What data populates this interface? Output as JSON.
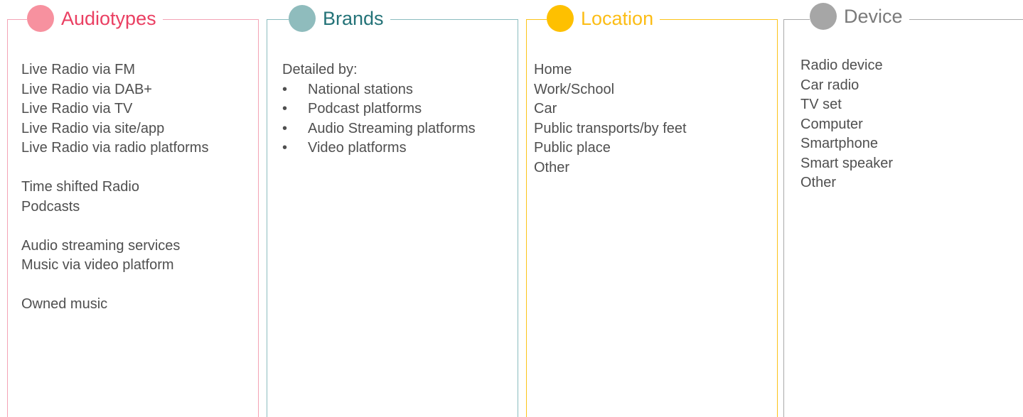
{
  "panels": [
    {
      "title": "Audiotypes",
      "groups": [
        [
          "Live Radio via FM",
          "Live Radio via DAB+",
          "Live Radio via TV",
          "Live Radio via site/app",
          "Live Radio via radio platforms"
        ],
        [
          "Time shifted Radio",
          "Podcasts"
        ],
        [
          "Audio streaming services",
          "Music via video platform"
        ],
        [
          "Owned music"
        ]
      ],
      "colors": {
        "dot": "#f7919f",
        "title": "#ea3f62",
        "border": "#f4a3b5"
      }
    },
    {
      "title": "Brands",
      "intro": "Detailed by:",
      "bullet": "•",
      "bullets": [
        "National stations",
        "Podcast platforms",
        "Audio Streaming platforms",
        "Video platforms"
      ],
      "colors": {
        "dot": "#8fbcbd",
        "title": "#247378",
        "border": "#8bbcbf"
      }
    },
    {
      "title": "Location",
      "items": [
        "Home",
        "Work/School",
        "Car",
        "Public transports/by feet",
        "Public place",
        "Other"
      ],
      "colors": {
        "dot": "#fec000",
        "title": "#fcbd16",
        "border": "#fcc419"
      }
    },
    {
      "title": "Device",
      "items": [
        "Radio device",
        "Car radio",
        "TV set",
        "Computer",
        "Smartphone",
        "Smart speaker",
        "Other"
      ],
      "colors": {
        "dot": "#a6a6a6",
        "title": "#7a7a7a",
        "border": "#aaaaaa"
      }
    }
  ]
}
